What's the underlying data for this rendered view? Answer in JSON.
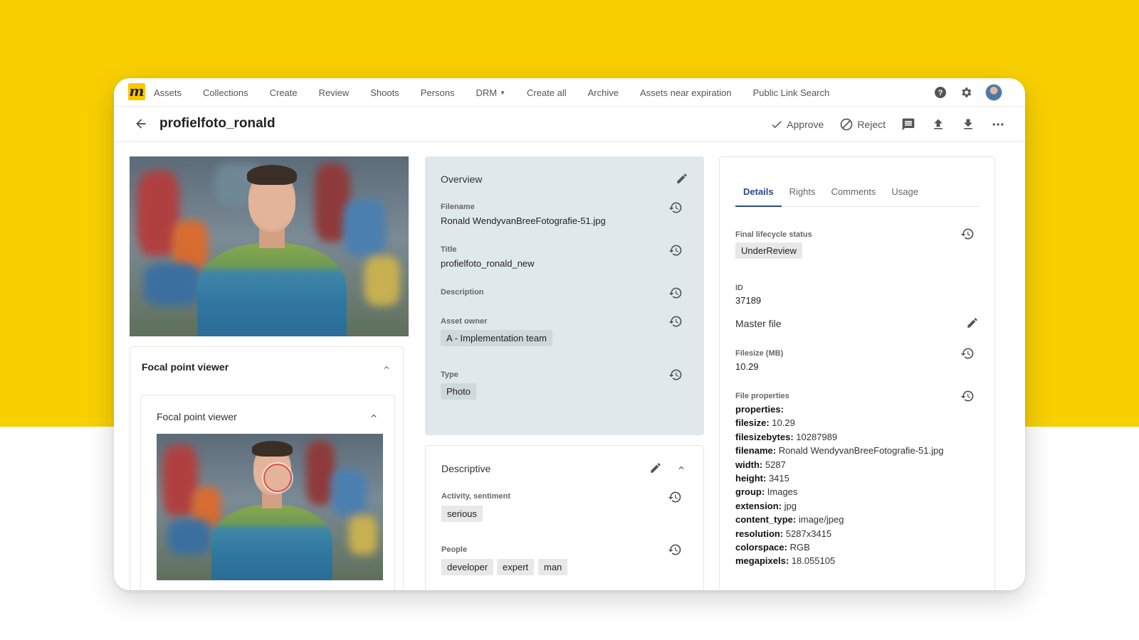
{
  "nav": {
    "items": [
      "Assets",
      "Collections",
      "Create",
      "Review",
      "Shoots",
      "Persons",
      "DRM",
      "Create all",
      "Archive",
      "Assets near expiration",
      "Public Link Search"
    ],
    "logo": "m"
  },
  "header": {
    "title": "profielfoto_ronald",
    "approve_label": "Approve",
    "reject_label": "Reject"
  },
  "focal": {
    "outer_title": "Focal point viewer",
    "inner_title": "Focal point viewer"
  },
  "overview": {
    "title": "Overview",
    "filename_label": "Filename",
    "filename_value": "Ronald WendyvanBreeFotografie-51.jpg",
    "title_label": "Title",
    "title_value": "profielfoto_ronald_new",
    "description_label": "Description",
    "owner_label": "Asset owner",
    "owner_value": "A - Implementation team",
    "type_label": "Type",
    "type_value": "Photo"
  },
  "descriptive": {
    "title": "Descriptive",
    "activity_label": "Activity, sentiment",
    "activity_value": "serious",
    "people_label": "People",
    "people_tags": [
      "developer",
      "expert",
      "man"
    ]
  },
  "details": {
    "tabs": [
      "Details",
      "Rights",
      "Comments",
      "Usage"
    ],
    "active_tab": "Details",
    "lifecycle_label": "Final lifecycle status",
    "lifecycle_value": "UnderReview",
    "id_label": "ID",
    "id_value": "37189",
    "master_file_label": "Master file",
    "filesize_label": "Filesize (MB)",
    "filesize_value": "10.29",
    "file_properties_label": "File properties",
    "properties": [
      {
        "key": "properties:",
        "value": ""
      },
      {
        "key": "filesize:",
        "value": " 10.29"
      },
      {
        "key": "filesizebytes:",
        "value": " 10287989"
      },
      {
        "key": "filename:",
        "value": " Ronald WendyvanBreeFotografie-51.jpg"
      },
      {
        "key": "width:",
        "value": " 5287"
      },
      {
        "key": "height:",
        "value": " 3415"
      },
      {
        "key": "group:",
        "value": " Images"
      },
      {
        "key": "extension:",
        "value": " jpg"
      },
      {
        "key": "content_type:",
        "value": " image/jpeg"
      },
      {
        "key": "resolution:",
        "value": " 5287x3415"
      },
      {
        "key": "colorspace:",
        "value": " RGB"
      },
      {
        "key": "megapixels:",
        "value": " 18.055105"
      }
    ]
  },
  "colors": {
    "background_yellow": "#f8d000",
    "overview_panel": "#dfe9ec",
    "active_tab": "#2a4a8c",
    "focal_circle": "#e05050"
  }
}
